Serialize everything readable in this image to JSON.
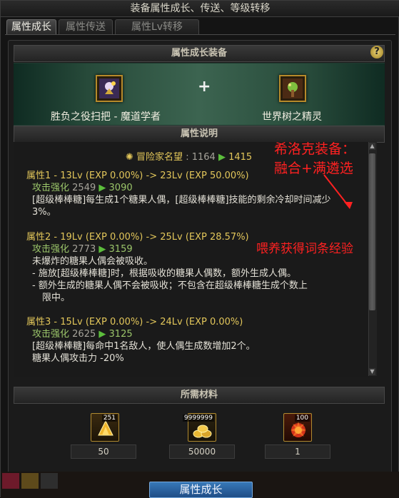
{
  "window": {
    "title": "装备属性成长、传送、等级转移"
  },
  "tabs": [
    {
      "label": "属性成长",
      "active": true
    },
    {
      "label": "属性传送",
      "active": false
    },
    {
      "label": "属性Lv转移",
      "active": false
    }
  ],
  "sections": {
    "equip_header": "属性成长装备",
    "desc_header": "属性说明",
    "materials_header": "所需材料"
  },
  "help_icon": "?",
  "equip": {
    "plus": "+",
    "left_name": "胜负之役扫把 - 魔道学者",
    "right_name": "世界树之精灵"
  },
  "adventurer": {
    "label": "冒险家名望",
    "from": ": 1164",
    "to": "1415"
  },
  "attributes": [
    {
      "header": "属性1 - 13Lv (EXP 0.00%) -> 23Lv (EXP 50.00%)",
      "strength_label": "攻击强化",
      "from": "2549",
      "to": "3090",
      "desc": [
        "[超级棒棒糖]每生成1个糖果人偶，[超级棒棒糖]技能的剩余冷却时间减少",
        "3%。"
      ]
    },
    {
      "header": "属性2 - 19Lv (EXP 0.00%) -> 25Lv (EXP 28.57%)",
      "strength_label": "攻击强化",
      "from": "2773",
      "to": "3159",
      "desc": [
        "未爆炸的糖果人偶会被吸收。",
        "- 施放[超级棒棒糖]时，根据吸收的糖果人偶数，额外生成人偶。",
        "- 额外生成的糖果人偶不会被吸收；不包含在超级棒棒糖生成个数上",
        "限中。"
      ]
    },
    {
      "header": "属性3 - 15Lv (EXP 0.00%) -> 24Lv (EXP 0.00%)",
      "strength_label": "攻击强化",
      "from": "2625",
      "to": "3125",
      "desc": [
        "[超级棒棒糖]每命中1名敌人，使人偶生成数增加2个。",
        "糖果人偶攻击力 -20%"
      ]
    }
  ],
  "annotations": {
    "line1": "希洛克装备：",
    "line2": "融合+满遴选",
    "line3": "喂养获得词条经验"
  },
  "materials": [
    {
      "icon": "gold-shard-icon",
      "count": "251",
      "value": "50"
    },
    {
      "icon": "gold-coins-icon",
      "count": "9999999",
      "value": "50000"
    },
    {
      "icon": "fire-orb-icon",
      "count": "100",
      "value": "1"
    }
  ],
  "main_button": "属性成长",
  "colors": {
    "annotation": "#ff2121",
    "attr_header": "#e2c65a",
    "strength": "#9bc56a",
    "arrow": "#5cbd3c"
  }
}
